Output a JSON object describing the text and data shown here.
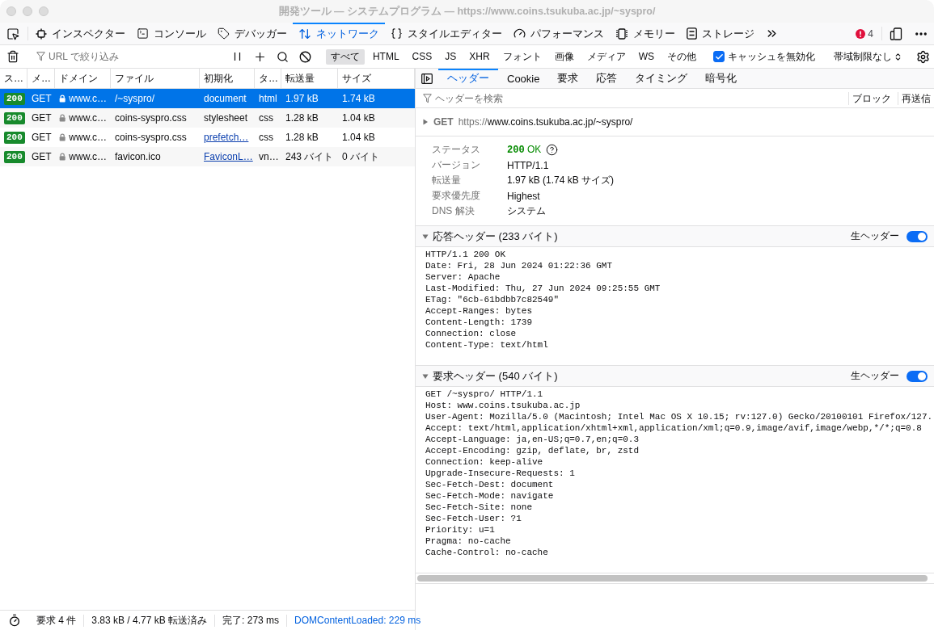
{
  "window": {
    "title": "開発ツール — システムプログラム — https://www.coins.tsukuba.ac.jp/~syspro/"
  },
  "toolbox": {
    "tools": [
      {
        "kind": "inspector",
        "label": "インスペクター",
        "selected": false
      },
      {
        "kind": "console",
        "label": "コンソール",
        "selected": false
      },
      {
        "kind": "debugger",
        "label": "デバッガー",
        "selected": false
      },
      {
        "kind": "network",
        "label": "ネットワーク",
        "selected": true
      },
      {
        "kind": "style-editor",
        "label": "スタイルエディター",
        "selected": false
      },
      {
        "kind": "performance",
        "label": "パフォーマンス",
        "selected": false
      },
      {
        "kind": "memory",
        "label": "メモリー",
        "selected": false
      },
      {
        "kind": "storage",
        "label": "ストレージ",
        "selected": false
      }
    ],
    "error_count": "4"
  },
  "network_toolbar": {
    "filter": {
      "placeholder": "URL で絞り込み"
    },
    "type_filters": [
      {
        "label": "すべて",
        "selected": true
      },
      {
        "label": "HTML",
        "selected": false
      },
      {
        "label": "CSS",
        "selected": false
      },
      {
        "label": "JS",
        "selected": false
      },
      {
        "label": "XHR",
        "selected": false
      },
      {
        "label": "フォント",
        "selected": false
      },
      {
        "label": "画像",
        "selected": false
      },
      {
        "label": "メディア",
        "selected": false
      },
      {
        "label": "WS",
        "selected": false
      },
      {
        "label": "その他",
        "selected": false
      }
    ],
    "disable_cache": {
      "label": "キャッシュを無効化",
      "checked": true
    },
    "throttling": "帯域制限なし"
  },
  "requests": {
    "columns": [
      "ス…",
      "メ…",
      "ドメイン",
      "ファイル",
      "初期化",
      "タ…",
      "転送量",
      "サイズ"
    ],
    "rows": [
      {
        "selected": true,
        "status": "200",
        "method": "GET",
        "domain": "www.c…",
        "file": "/~syspro/",
        "initiator": {
          "text": "document",
          "link": false
        },
        "type": "html",
        "transferred": "1.97 kB",
        "size": "1.74 kB"
      },
      {
        "selected": false,
        "status": "200",
        "method": "GET",
        "domain": "www.c…",
        "file": "coins-syspro.css",
        "initiator": {
          "text": "stylesheet",
          "link": false
        },
        "type": "css",
        "transferred": "1.28 kB",
        "size": "1.04 kB"
      },
      {
        "selected": false,
        "status": "200",
        "method": "GET",
        "domain": "www.c…",
        "file": "coins-syspro.css",
        "initiator": {
          "text": "prefetch…",
          "link": true
        },
        "type": "css",
        "transferred": "1.28 kB",
        "size": "1.04 kB"
      },
      {
        "selected": false,
        "status": "200",
        "method": "GET",
        "domain": "www.c…",
        "file": "favicon.ico",
        "initiator": {
          "text": "FaviconL…",
          "link": true
        },
        "type": "vn…",
        "transferred": "243 バイト",
        "size": "0 バイト"
      }
    ]
  },
  "status_bar": {
    "requests": "要求 4 件",
    "transferred": "3.83 kB / 4.77 kB 転送済み",
    "finish": "完了: 273 ms",
    "dom_content_loaded": "DOMContentLoaded: 229 ms"
  },
  "details": {
    "tabs": [
      {
        "label": "ヘッダー",
        "selected": true
      },
      {
        "label": "Cookie",
        "selected": false
      },
      {
        "label": "要求",
        "selected": false
      },
      {
        "label": "応答",
        "selected": false
      },
      {
        "label": "タイミング",
        "selected": false
      },
      {
        "label": "暗号化",
        "selected": false
      }
    ],
    "filter": {
      "placeholder": "ヘッダーを検索"
    },
    "actions": [
      "ブロック",
      "再送信"
    ],
    "request_line": {
      "expanded": false,
      "method": "GET",
      "scheme": "https://",
      "address": "www.coins.tsukuba.ac.jp/~syspro/"
    },
    "summary": [
      {
        "kind": "status",
        "label": "ステータス",
        "code": "200",
        "text": "OK"
      },
      {
        "kind": "text",
        "label": "バージョン",
        "value": "HTTP/1.1"
      },
      {
        "kind": "text",
        "label": "転送量",
        "value": "1.97 kB (1.74 kB サイズ)"
      },
      {
        "kind": "text",
        "label": "要求優先度",
        "value": "Highest"
      },
      {
        "kind": "text",
        "label": "DNS 解決",
        "value": "システム"
      }
    ],
    "sections": [
      {
        "title": "応答ヘッダー (233 バイト)",
        "expanded": true,
        "raw": {
          "label": "生ヘッダー",
          "on": true
        },
        "lines": [
          "HTTP/1.1 200 OK",
          "Date: Fri, 28 Jun 2024 01:22:36 GMT",
          "Server: Apache",
          "Last-Modified: Thu, 27 Jun 2024 09:25:55 GMT",
          "ETag: \"6cb-61bdbb7c82549\"",
          "Accept-Ranges: bytes",
          "Content-Length: 1739",
          "Connection: close",
          "Content-Type: text/html"
        ]
      },
      {
        "title": "要求ヘッダー (540 バイト)",
        "expanded": true,
        "raw": {
          "label": "生ヘッダー",
          "on": true
        },
        "lines": [
          "GET /~syspro/ HTTP/1.1",
          "Host: www.coins.tsukuba.ac.jp",
          "User-Agent: Mozilla/5.0 (Macintosh; Intel Mac OS X 10.15; rv:127.0) Gecko/20100101 Firefox/127.",
          "Accept: text/html,application/xhtml+xml,application/xml;q=0.9,image/avif,image/webp,*/*;q=0.8",
          "Accept-Language: ja,en-US;q=0.7,en;q=0.3",
          "Accept-Encoding: gzip, deflate, br, zstd",
          "Connection: keep-alive",
          "Upgrade-Insecure-Requests: 1",
          "Sec-Fetch-Dest: document",
          "Sec-Fetch-Mode: navigate",
          "Sec-Fetch-Site: none",
          "Sec-Fetch-User: ?1",
          "Priority: u=1",
          "Pragma: no-cache",
          "Cache-Control: no-cache"
        ]
      }
    ]
  }
}
